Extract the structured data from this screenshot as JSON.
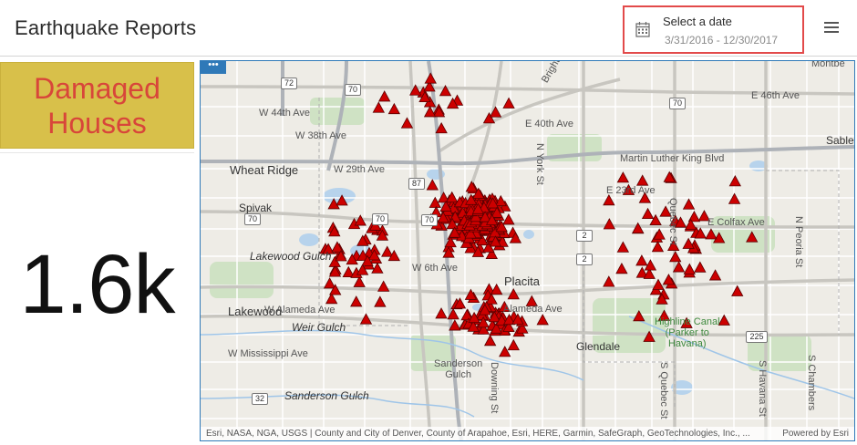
{
  "header": {
    "title": "Earthquake Reports",
    "date_selector": {
      "label": "Select a date",
      "range": "3/31/2016 - 12/30/2017"
    }
  },
  "indicator": {
    "title_line1": "Damaged",
    "title_line2": "Houses",
    "value": "1.6k"
  },
  "map": {
    "options_label": "•••",
    "labels": {
      "wheat_ridge": "Wheat Ridge",
      "spivak": "Spivak",
      "lakewood": "Lakewood",
      "lakewood_gulch": "Lakewood Gulch",
      "weir_gulch": "Weir Gulch",
      "sanderson_gulch": "Sanderson Gulch",
      "sanderson": "Sanderson\nGulch",
      "placita": "Placita",
      "glendale": "Glendale",
      "highline": "Highline Canal\n(Parker to\nHavana)",
      "sable": "Sable",
      "montbello": "Montbe",
      "w44": "W 44th Ave",
      "w38": "W 38th Ave",
      "w29": "W 29th Ave",
      "w6": "W 6th Ave",
      "w_alameda": "W Alameda Ave",
      "w_mississippi": "W Mississippi Ave",
      "e40": "E 40th Ave",
      "e23": "E 23rd Ave",
      "e_colfax": "E Colfax Ave",
      "alameda": "Alameda Ave",
      "mlk": "Martin Luther King Blvd",
      "e46": "E 46th Ave",
      "brighton": "Brighton Blvd",
      "n_york": "N York St",
      "quebec": "Quebec St",
      "peoria": "N Peoria St",
      "havana": "S Havana St",
      "chambers": "S Chambers",
      "downing": "Downing St",
      "s_quebec": "S Quebec St"
    },
    "shields": {
      "s72": "72",
      "s70a": "70",
      "s70b": "70",
      "s70c": "70",
      "s87": "87",
      "s70d": "70",
      "s2a": "2",
      "s2b": "2",
      "s225": "225",
      "s32": "32",
      "s70e": "70"
    },
    "attribution": "Esri, NASA, NGA, USGS | County and City of Denver, County of Arapahoe, Esri, HERE, Garmin, SafeGraph, GeoTechnologies, Inc., ...",
    "powered_by": "Powered by Esri",
    "marker_color": "#cc0000"
  },
  "colors": {
    "accent": "#2f79b8",
    "indicator_bg": "#d8c04a",
    "indicator_title": "#d8463a",
    "highlight_border": "#e24a4a"
  }
}
